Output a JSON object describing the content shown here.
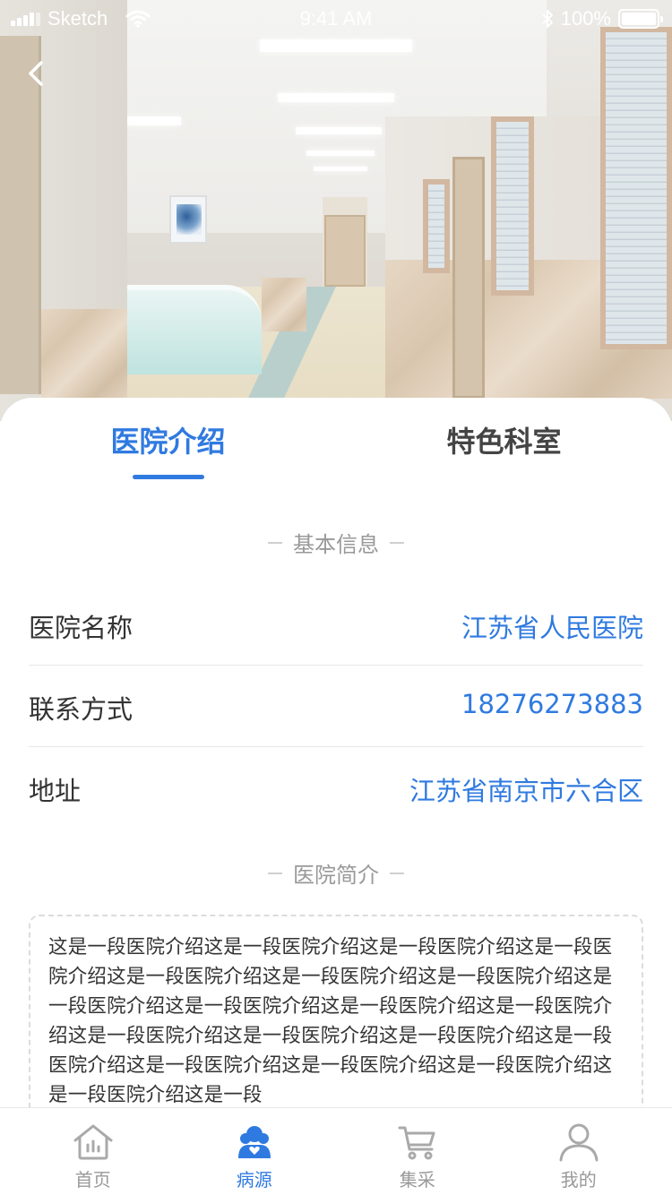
{
  "status_bar": {
    "carrier": "Sketch",
    "time": "9:41 AM",
    "battery": "100%"
  },
  "tabs": [
    {
      "label": "医院介绍",
      "active": true
    },
    {
      "label": "特色科室",
      "active": false
    }
  ],
  "basic_info": {
    "section_title": "基本信息",
    "rows": [
      {
        "label": "医院名称",
        "value": "江苏省人民医院"
      },
      {
        "label": "联系方式",
        "value": "18276273883"
      },
      {
        "label": "地址",
        "value": "江苏省南京市六合区"
      }
    ]
  },
  "intro": {
    "section_title": "医院简介",
    "text": "这是一段医院介绍这是一段医院介绍这是一段医院介绍这是一段医院介绍这是一段医院介绍这是一段医院介绍这是一段医院介绍这是一段医院介绍这是一段医院介绍这是一段医院介绍这是一段医院介绍这是一段医院介绍这是一段医院介绍这是一段医院介绍这是一段医院介绍这是一段医院介绍这是一段医院介绍这是一段医院介绍这是一段医院介绍这是一段"
  },
  "bottom_nav": [
    {
      "label": "首页",
      "icon": "home-chart-icon",
      "active": false
    },
    {
      "label": "病源",
      "icon": "patient-source-icon",
      "active": true
    },
    {
      "label": "集采",
      "icon": "cart-icon",
      "active": false
    },
    {
      "label": "我的",
      "icon": "profile-icon",
      "active": false
    }
  ],
  "colors": {
    "accent": "#2f7ae0",
    "text": "#333333",
    "muted": "#999999"
  }
}
